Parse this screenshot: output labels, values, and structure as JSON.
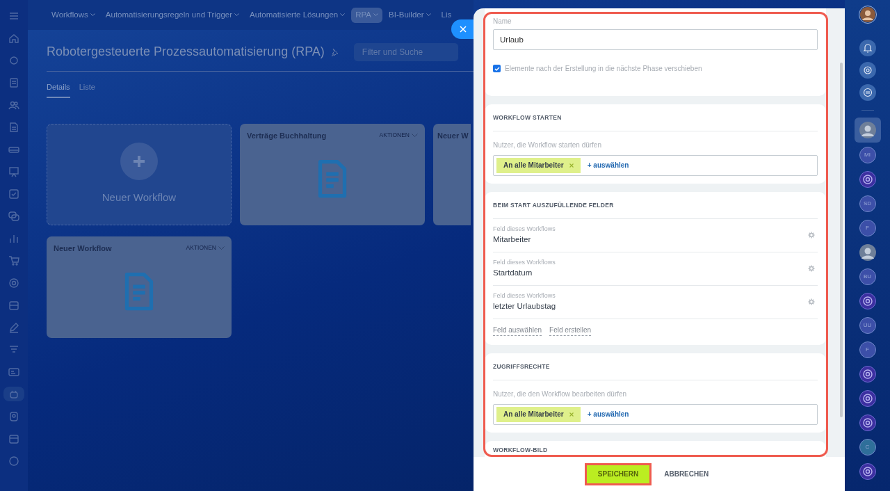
{
  "top_nav": [
    {
      "label": "Workflows",
      "selected": false
    },
    {
      "label": "Automatisierungsregeln und Trigger",
      "selected": false
    },
    {
      "label": "Automatisierte Lösungen",
      "selected": false
    },
    {
      "label": "RPA",
      "selected": true
    },
    {
      "label": "BI-Builder",
      "selected": false
    },
    {
      "label": "Lis",
      "selected": false
    }
  ],
  "page": {
    "title": "Robotergesteuerte Prozessautomatisierung (RPA)",
    "search": {
      "placeholder": "Filter und Suche"
    },
    "tabs": [
      {
        "label": "Details",
        "selected": true
      },
      {
        "label": "Liste",
        "selected": false
      }
    ]
  },
  "cards": [
    {
      "kind": "new",
      "label": "Neuer Workflow"
    },
    {
      "kind": "workflow",
      "title": "Verträge Buchhaltung",
      "actions": "AKTIONEN"
    },
    {
      "kind": "workflow",
      "title": "Neuer W"
    },
    {
      "kind": "workflow",
      "title": "Neuer Workflow",
      "actions": "AKTIONEN"
    }
  ],
  "slider": {
    "name": {
      "label": "Name",
      "value": "Urlaub"
    },
    "move_checkbox": {
      "label": "Elemente nach der Erstellung in die nächste Phase verschieben",
      "checked": true
    },
    "start": {
      "heading": "WORKFLOW STARTEN",
      "label": "Nutzer, die Workflow starten dürfen",
      "tags": [
        "An alle Mitarbeiter"
      ],
      "add": "+ auswählen"
    },
    "fields": {
      "heading": "BEIM START AUSZUFÜLLENDE FELDER",
      "items": [
        {
          "caption": "Feld dieses Workflows",
          "name": "Mitarbeiter"
        },
        {
          "caption": "Feld dieses Workflows",
          "name": "Startdatum"
        },
        {
          "caption": "Feld dieses Workflows",
          "name": "letzter Urlaubstag"
        }
      ],
      "links": [
        "Feld auswählen",
        "Feld erstellen"
      ]
    },
    "access": {
      "heading": "ZUGRIFFSRECHTE",
      "label": "Nutzer, die den Workflow bearbeiten dürfen",
      "tags": [
        "An alle Mitarbeiter"
      ],
      "add": "+ auswählen"
    },
    "image": {
      "heading": "WORKFLOW-BILD"
    },
    "buttons": {
      "save": "SPEICHERN",
      "cancel": "ABBRECHEN"
    }
  },
  "contacts": [
    {
      "kind": "photo",
      "selected": true
    },
    {
      "kind": "initials",
      "initials": "MI",
      "selected": false
    },
    {
      "kind": "chat",
      "selected": false
    },
    {
      "kind": "initials",
      "initials": "SD",
      "selected": false
    },
    {
      "kind": "initials",
      "initials": "F",
      "selected": false
    },
    {
      "kind": "photo",
      "selected": false
    },
    {
      "kind": "initials",
      "initials": "BU",
      "selected": false
    },
    {
      "kind": "chat",
      "selected": false
    },
    {
      "kind": "initials",
      "initials": "ÜU",
      "selected": false
    },
    {
      "kind": "initials",
      "initials": "F",
      "selected": false
    },
    {
      "kind": "chat",
      "selected": false
    },
    {
      "kind": "chat",
      "selected": false
    },
    {
      "kind": "chat",
      "selected": false
    },
    {
      "kind": "initials",
      "initials": "C",
      "selected": false,
      "color": "#2f6f9a"
    },
    {
      "kind": "chat",
      "selected": false
    }
  ]
}
